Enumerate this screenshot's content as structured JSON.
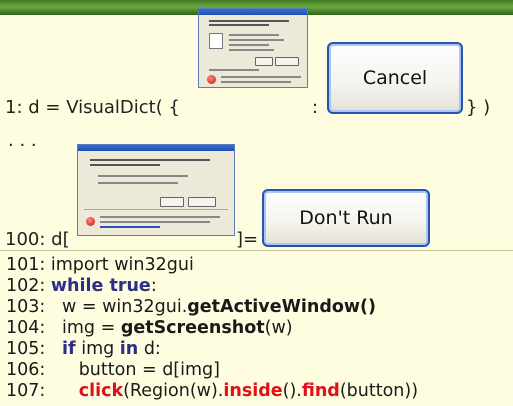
{
  "slide": {
    "line1_prefix": "1: d = VisualDict( {",
    "line1_colon": ":",
    "line1_suffix": "} )",
    "ellipsis": ". . .",
    "line100_prefix": "100: d[",
    "line100_suffix": "]=",
    "cancel_label": "Cancel",
    "dontrun_label": "Don't Run"
  },
  "code_lines": [
    {
      "num": "101:",
      "text": "import win32gui"
    },
    {
      "num": "102:",
      "kw": "while true",
      "rest": ":"
    },
    {
      "num": "103:",
      "pre": "   w = win32gui.",
      "bold": "getActiveWindow()"
    },
    {
      "num": "104:",
      "pre": "   img = ",
      "bold": "getScreenshot",
      "post": "(w)"
    },
    {
      "num": "105:",
      "pre": "   ",
      "kw": "if",
      "mid": " img ",
      "kw2": "in",
      "post": " d:"
    },
    {
      "num": "106:",
      "pre": "      button = d[img]"
    },
    {
      "num": "107:",
      "pre": "      ",
      "fn": "click",
      "mid": "(Region(w).",
      "fn2": "inside",
      "mid2": "().",
      "fn3": "find",
      "post": "(button))"
    }
  ],
  "colors": {
    "keyword": "#2b2f86",
    "function": "#e0101a",
    "background": "#fffde0",
    "button_border": "#2a52b0"
  }
}
